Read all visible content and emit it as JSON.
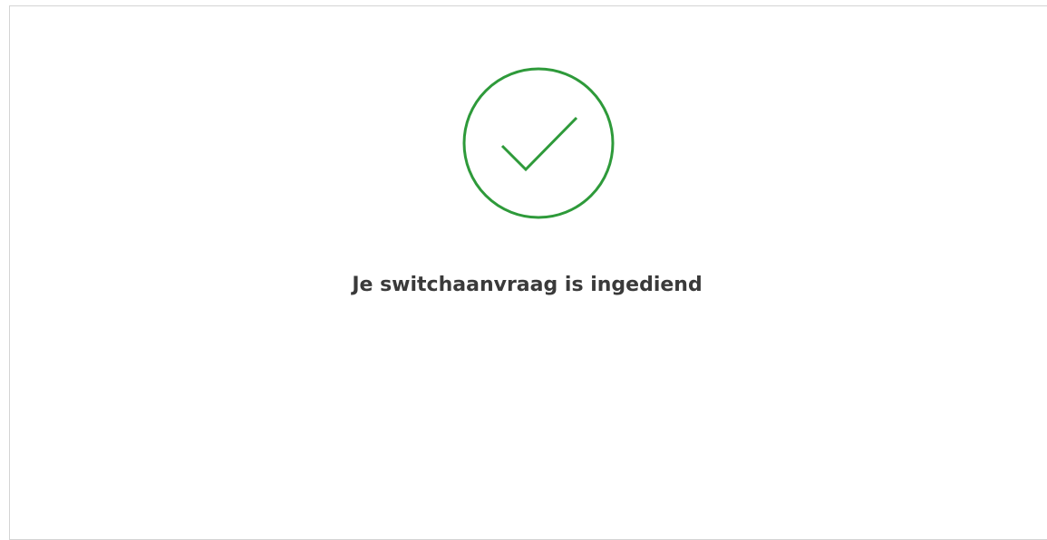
{
  "confirmation": {
    "icon": "checkmark-circle-icon",
    "message": "Je switchaanvraag is ingediend",
    "accent_color": "#2e9a3a"
  }
}
